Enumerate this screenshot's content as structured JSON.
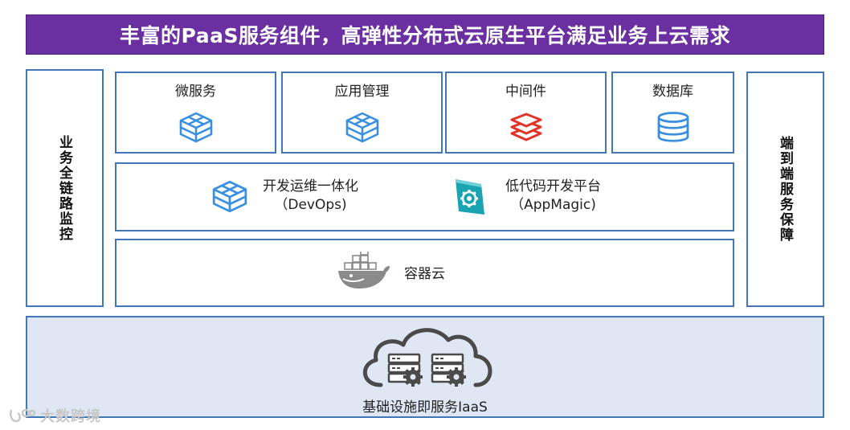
{
  "banner": {
    "title": "丰富的PaaS服务组件，高弹性分布式云原生平台满足业务上云需求"
  },
  "left_panel": {
    "label": "业务全链路监控"
  },
  "right_panel": {
    "label": "端到端服务保障"
  },
  "top_services": [
    {
      "label": "微服务",
      "icon": "cube-icon"
    },
    {
      "label": "应用管理",
      "icon": "cube-icon"
    },
    {
      "label": "中间件",
      "icon": "layers-icon"
    },
    {
      "label": "数据库",
      "icon": "database-icon"
    }
  ],
  "middle_row": {
    "devops": {
      "line1": "开发运维一体化",
      "line2": "（DevOps)",
      "icon": "cube-icon"
    },
    "lowcode": {
      "line1": "低代码开发平台",
      "line2": "（AppMagic)",
      "icon": "gear-icon"
    }
  },
  "container_cloud": {
    "label": "容器云",
    "icon": "docker-whale-icon"
  },
  "iaas": {
    "label": "基础设施即服务IaaS",
    "icon": "cloud-servers-icon"
  },
  "watermark": {
    "text": "大数跨境"
  },
  "colors": {
    "banner": "#6a2fa0",
    "border": "#3f78b5",
    "iaas_fill": "#dfe7f4",
    "icon_blue": "#3b8fe0",
    "icon_red": "#e0342b",
    "icon_teal": "#1aa3b0"
  }
}
